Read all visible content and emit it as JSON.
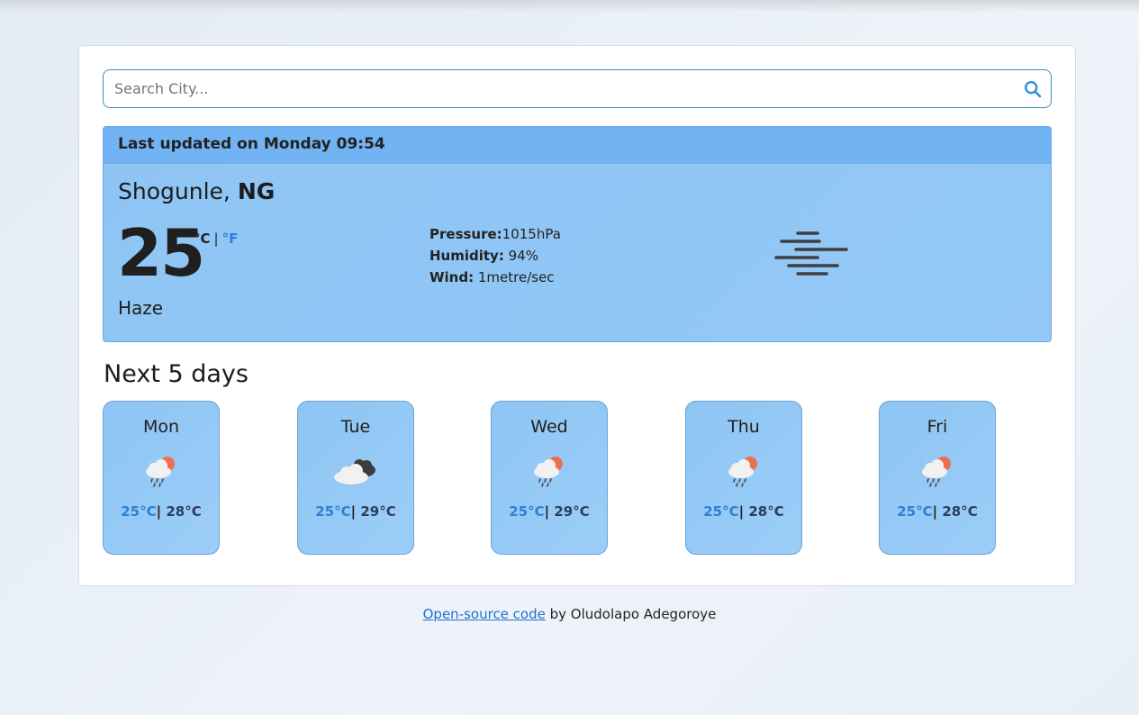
{
  "search": {
    "placeholder": "Search City..."
  },
  "current": {
    "last_updated": "Last updated on Monday 09:54",
    "city": "Shogunle",
    "country": "NG",
    "city_separator": ", ",
    "temperature": "25",
    "unit_c": "°C",
    "unit_separator": "|",
    "unit_f": "°F",
    "condition": "Haze",
    "icon": "haze-icon",
    "pressure_label": "Pressure:",
    "pressure_value": "1015hPa",
    "humidity_label": "Humidity:",
    "humidity_value": " 94%",
    "wind_label": "Wind:",
    "wind_value": " 1metre/sec"
  },
  "forecast": {
    "title": "Next 5 days",
    "days": [
      {
        "name": "Mon",
        "icon": "rain-sun-icon",
        "low": "25°C",
        "high": " 28°C"
      },
      {
        "name": "Tue",
        "icon": "clouds-icon",
        "low": "25°C",
        "high": " 29°C"
      },
      {
        "name": "Wed",
        "icon": "rain-sun-icon",
        "low": "25°C",
        "high": " 29°C"
      },
      {
        "name": "Thu",
        "icon": "rain-sun-icon",
        "low": "25°C",
        "high": " 28°C"
      },
      {
        "name": "Fri",
        "icon": "rain-sun-icon",
        "low": "25°C",
        "high": " 28°C"
      }
    ],
    "temp_separator": "|"
  },
  "footer": {
    "link_text": "Open-source code",
    "suffix": " by Oludolapo Adegoroye"
  },
  "colors": {
    "accent": "#2a7ee0",
    "card_bg": "#8ec5f4",
    "header_bg": "#72b4f3"
  }
}
